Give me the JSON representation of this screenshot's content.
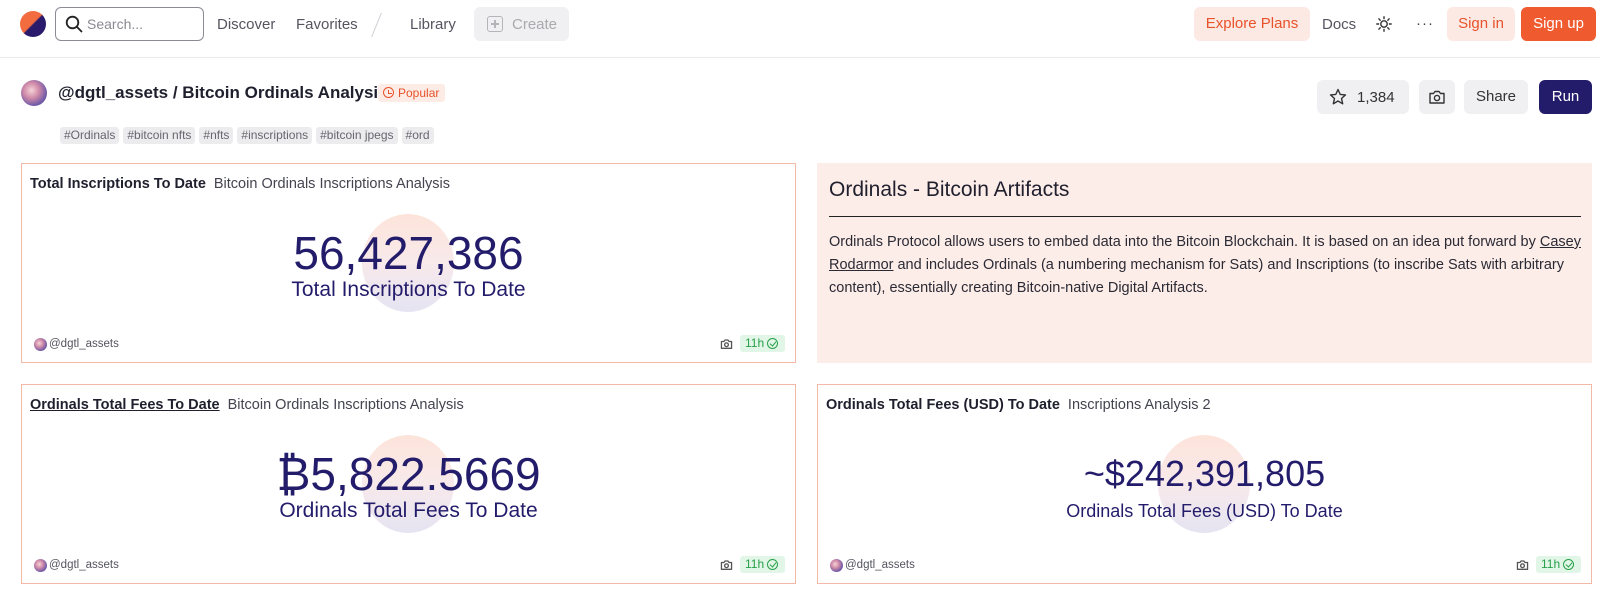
{
  "nav": {
    "search_placeholder": "Search...",
    "discover": "Discover",
    "favorites": "Favorites",
    "library": "Library",
    "create": "Create",
    "explore_plans": "Explore Plans",
    "docs": "Docs",
    "more": "···",
    "sign_in": "Sign in",
    "sign_up": "Sign up"
  },
  "dashboard": {
    "title": "@dgtl_assets / Bitcoin Ordinals Analysis",
    "badge": "Popular",
    "tags": [
      "#Ordinals",
      "#bitcoin nfts",
      "#nfts",
      "#inscriptions",
      "#bitcoin jpegs",
      "#ord"
    ],
    "star_count": "1,384",
    "share": "Share",
    "run": "Run"
  },
  "cards": [
    {
      "title": "Total Inscriptions To Date",
      "subtitle": "Bitcoin Ordinals Inscriptions Analysis",
      "value": "56,427,386",
      "label": "Total Inscriptions To Date",
      "owner": "@dgtl_assets",
      "age": "11h"
    },
    {
      "title": "Ordinals Total Fees To Date",
      "subtitle": "Bitcoin Ordinals Inscriptions Analysis",
      "value": "₿5,822.5669",
      "label": "Ordinals Total Fees To Date",
      "owner": "@dgtl_assets",
      "age": "11h"
    },
    {
      "title": "Ordinals Total Fees (USD) To Date",
      "subtitle": "Inscriptions Analysis 2",
      "value": "~$242,391,805",
      "label": "Ordinals Total Fees (USD) To Date",
      "owner": "@dgtl_assets",
      "age": "11h"
    }
  ],
  "text_card": {
    "heading": "Ordinals - Bitcoin Artifacts",
    "para_before_link": "Ordinals Protocol allows users to embed data into the Bitcoin Blockchain. It is based on an idea put forward by ",
    "link": "Casey Rodarmor",
    "para_after_link": " and includes Ordinals (a numbering mechanism for Sats) and Inscriptions (to inscribe Sats with arbitrary content), essentially creating Bitcoin-native Digital Artifacts."
  },
  "colors": {
    "brand_orange": "#f05a2f",
    "brand_navy": "#231c6b",
    "card_border": "#f3b8a6",
    "text_card_bg": "#fdede8",
    "fresh_green": "#28a04a"
  }
}
